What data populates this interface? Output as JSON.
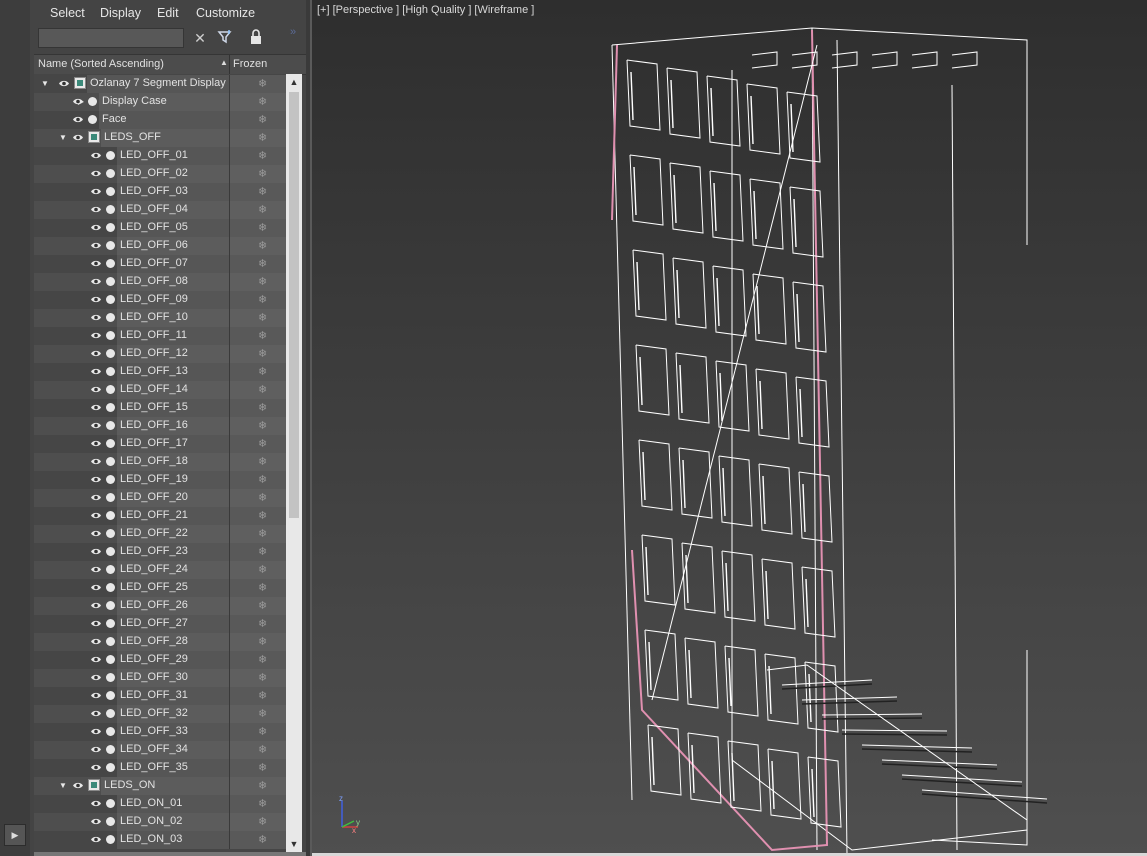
{
  "menu": {
    "select": "Select",
    "display": "Display",
    "edit": "Edit",
    "customize": "Customize"
  },
  "search": {
    "value": ""
  },
  "header": {
    "name_col": "Name (Sorted Ascending)",
    "frozen_col": "Frozen"
  },
  "tree": [
    {
      "label": "Ozlanay 7 Segment Display",
      "level": 0,
      "type": "layer",
      "expanded": true
    },
    {
      "label": "Display Case",
      "level": 1,
      "type": "object",
      "collapsed": true
    },
    {
      "label": "Face",
      "level": 1,
      "type": "object"
    },
    {
      "label": "LEDS_OFF",
      "level": 1,
      "type": "layer",
      "expanded": true
    },
    {
      "label": "LED_OFF_01",
      "level": 2,
      "type": "object"
    },
    {
      "label": "LED_OFF_02",
      "level": 2,
      "type": "object"
    },
    {
      "label": "LED_OFF_03",
      "level": 2,
      "type": "object"
    },
    {
      "label": "LED_OFF_04",
      "level": 2,
      "type": "object"
    },
    {
      "label": "LED_OFF_05",
      "level": 2,
      "type": "object"
    },
    {
      "label": "LED_OFF_06",
      "level": 2,
      "type": "object"
    },
    {
      "label": "LED_OFF_07",
      "level": 2,
      "type": "object"
    },
    {
      "label": "LED_OFF_08",
      "level": 2,
      "type": "object"
    },
    {
      "label": "LED_OFF_09",
      "level": 2,
      "type": "object"
    },
    {
      "label": "LED_OFF_10",
      "level": 2,
      "type": "object"
    },
    {
      "label": "LED_OFF_11",
      "level": 2,
      "type": "object"
    },
    {
      "label": "LED_OFF_12",
      "level": 2,
      "type": "object"
    },
    {
      "label": "LED_OFF_13",
      "level": 2,
      "type": "object"
    },
    {
      "label": "LED_OFF_14",
      "level": 2,
      "type": "object"
    },
    {
      "label": "LED_OFF_15",
      "level": 2,
      "type": "object"
    },
    {
      "label": "LED_OFF_16",
      "level": 2,
      "type": "object"
    },
    {
      "label": "LED_OFF_17",
      "level": 2,
      "type": "object"
    },
    {
      "label": "LED_OFF_18",
      "level": 2,
      "type": "object"
    },
    {
      "label": "LED_OFF_19",
      "level": 2,
      "type": "object"
    },
    {
      "label": "LED_OFF_20",
      "level": 2,
      "type": "object"
    },
    {
      "label": "LED_OFF_21",
      "level": 2,
      "type": "object"
    },
    {
      "label": "LED_OFF_22",
      "level": 2,
      "type": "object"
    },
    {
      "label": "LED_OFF_23",
      "level": 2,
      "type": "object"
    },
    {
      "label": "LED_OFF_24",
      "level": 2,
      "type": "object"
    },
    {
      "label": "LED_OFF_25",
      "level": 2,
      "type": "object"
    },
    {
      "label": "LED_OFF_26",
      "level": 2,
      "type": "object"
    },
    {
      "label": "LED_OFF_27",
      "level": 2,
      "type": "object"
    },
    {
      "label": "LED_OFF_28",
      "level": 2,
      "type": "object"
    },
    {
      "label": "LED_OFF_29",
      "level": 2,
      "type": "object"
    },
    {
      "label": "LED_OFF_30",
      "level": 2,
      "type": "object"
    },
    {
      "label": "LED_OFF_31",
      "level": 2,
      "type": "object"
    },
    {
      "label": "LED_OFF_32",
      "level": 2,
      "type": "object"
    },
    {
      "label": "LED_OFF_33",
      "level": 2,
      "type": "object"
    },
    {
      "label": "LED_OFF_34",
      "level": 2,
      "type": "object"
    },
    {
      "label": "LED_OFF_35",
      "level": 2,
      "type": "object"
    },
    {
      "label": "LEDS_ON",
      "level": 1,
      "type": "layer",
      "expanded": true
    },
    {
      "label": "LED_ON_01",
      "level": 2,
      "type": "object"
    },
    {
      "label": "LED_ON_02",
      "level": 2,
      "type": "object"
    },
    {
      "label": "LED_ON_03",
      "level": 2,
      "type": "object"
    }
  ],
  "viewport": {
    "label": "[+] [Perspective ] [High Quality ] [Wireframe ]"
  },
  "axis": {
    "x": "x",
    "y": "y",
    "z": "z"
  },
  "colors": {
    "x_axis": "#d04040",
    "y_axis": "#40c040",
    "z_axis": "#4060e0",
    "selected_wire": "#e090b0",
    "wire": "#ffffff"
  }
}
